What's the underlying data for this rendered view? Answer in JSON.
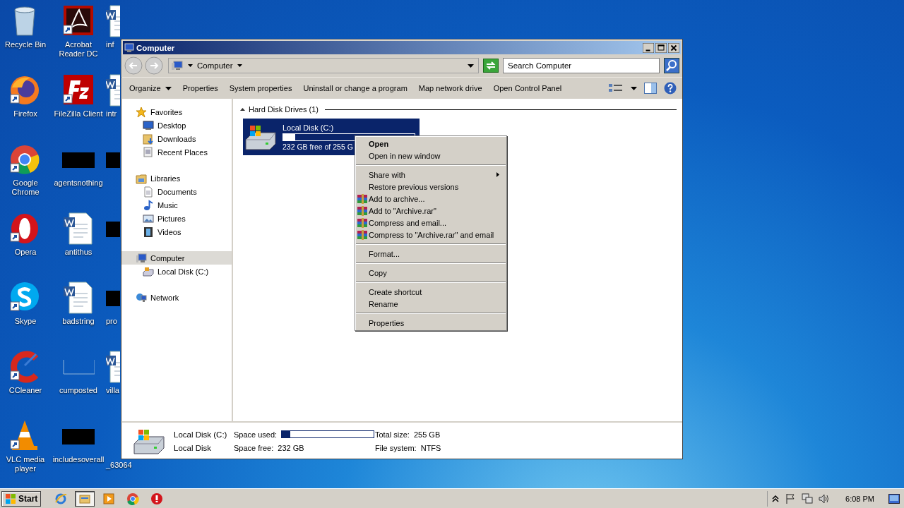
{
  "desktop": {
    "icons": [
      {
        "label": "Recycle Bin",
        "kind": "recycle"
      },
      {
        "label": "Firefox",
        "kind": "firefox"
      },
      {
        "label": "Google Chrome",
        "kind": "chrome"
      },
      {
        "label": "Opera",
        "kind": "opera"
      },
      {
        "label": "Skype",
        "kind": "skype"
      },
      {
        "label": "CCleaner",
        "kind": "ccleaner"
      },
      {
        "label": "VLC media player",
        "kind": "vlc"
      },
      {
        "label": "Acrobat Reader DC",
        "kind": "acrobat"
      },
      {
        "label": "FileZilla Client",
        "kind": "filezilla"
      },
      {
        "label": "agentsnothing",
        "kind": "black"
      },
      {
        "label": "antithus",
        "kind": "word"
      },
      {
        "label": "badstring",
        "kind": "word"
      },
      {
        "label": "cumposted",
        "kind": "blank"
      },
      {
        "label": "includesoverall",
        "kind": "black"
      },
      {
        "label": "inf",
        "kind": "word"
      },
      {
        "label": "intr",
        "kind": "word"
      },
      {
        "kind": "black"
      },
      {
        "kind": "black"
      },
      {
        "label": "pro",
        "kind": "black"
      },
      {
        "label": "villa",
        "kind": "word"
      },
      {
        "label": "_63064",
        "kind": "none"
      }
    ]
  },
  "window": {
    "title": "Computer",
    "address": {
      "crumb": "Computer"
    },
    "search": {
      "placeholder": "Search Computer"
    },
    "commands": [
      {
        "label": "Organize",
        "dropdown": true
      },
      {
        "label": "Properties",
        "dropdown": false
      },
      {
        "label": "System properties",
        "dropdown": false
      },
      {
        "label": "Uninstall or change a program",
        "dropdown": false
      },
      {
        "label": "Map network drive",
        "dropdown": false
      },
      {
        "label": "Open Control Panel",
        "dropdown": false
      }
    ],
    "nav": [
      {
        "label": "Favorites",
        "kind": "star",
        "selected": false,
        "children": [
          {
            "label": "Desktop",
            "kind": "desktop",
            "selected": false
          },
          {
            "label": "Downloads",
            "kind": "downloads",
            "selected": false
          },
          {
            "label": "Recent Places",
            "kind": "recent",
            "selected": false
          }
        ]
      },
      {
        "label": "Libraries",
        "kind": "library",
        "selected": false,
        "children": [
          {
            "label": "Documents",
            "kind": "document",
            "selected": false
          },
          {
            "label": "Music",
            "kind": "music",
            "selected": false
          },
          {
            "label": "Pictures",
            "kind": "pictures",
            "selected": false
          },
          {
            "label": "Videos",
            "kind": "videos",
            "selected": false
          }
        ]
      },
      {
        "label": "Computer",
        "kind": "computer",
        "selected": true,
        "children": [
          {
            "label": "Local Disk (C:)",
            "kind": "disk",
            "selected": false
          }
        ]
      },
      {
        "label": "Network",
        "kind": "network",
        "selected": false
      }
    ],
    "group": {
      "title": "Hard Disk Drives (1)",
      "expanded": true
    },
    "drives": [
      {
        "name": "Local Disk (C:)",
        "free": "232 GB free of 255 G",
        "level": 0.09,
        "selected": true
      }
    ],
    "details": {
      "name": "Local Disk (C:)",
      "type": "Local Disk",
      "fields": [
        {
          "label": "Space used:",
          "kind": "bar",
          "level": 0.09
        },
        {
          "label": "Total size:",
          "kind": "text",
          "value": "255 GB"
        },
        {
          "label": "Space free:",
          "kind": "text",
          "value": "232 GB"
        },
        {
          "label": "File system:",
          "kind": "text",
          "value": "NTFS"
        }
      ]
    }
  },
  "context_menu": {
    "items": [
      {
        "kind": "item",
        "label": "Open",
        "default": true
      },
      {
        "kind": "item",
        "label": "Open in new window"
      },
      {
        "kind": "separator"
      },
      {
        "kind": "item",
        "label": "Share with",
        "submenu": true
      },
      {
        "kind": "item",
        "label": "Restore previous versions"
      },
      {
        "kind": "item",
        "label": "Add to archive...",
        "rar": true
      },
      {
        "kind": "item",
        "label": "Add to \"Archive.rar\"",
        "rar": true
      },
      {
        "kind": "item",
        "label": "Compress and email...",
        "rar": true
      },
      {
        "kind": "item",
        "label": "Compress to \"Archive.rar\" and email",
        "rar": true
      },
      {
        "kind": "separator"
      },
      {
        "kind": "item",
        "label": "Format..."
      },
      {
        "kind": "separator"
      },
      {
        "kind": "item",
        "label": "Copy"
      },
      {
        "kind": "separator"
      },
      {
        "kind": "item",
        "label": "Create shortcut"
      },
      {
        "kind": "item",
        "label": "Rename"
      },
      {
        "kind": "separator"
      },
      {
        "kind": "item",
        "label": "Properties"
      }
    ]
  },
  "taskbar": {
    "start": "Start",
    "apps": [
      {
        "kind": "ie",
        "selected": false
      },
      {
        "kind": "explorer",
        "selected": true
      },
      {
        "kind": "media",
        "selected": false
      },
      {
        "kind": "chrome",
        "selected": false
      },
      {
        "kind": "opera",
        "selected": false
      }
    ],
    "clock": "6:08 PM"
  }
}
